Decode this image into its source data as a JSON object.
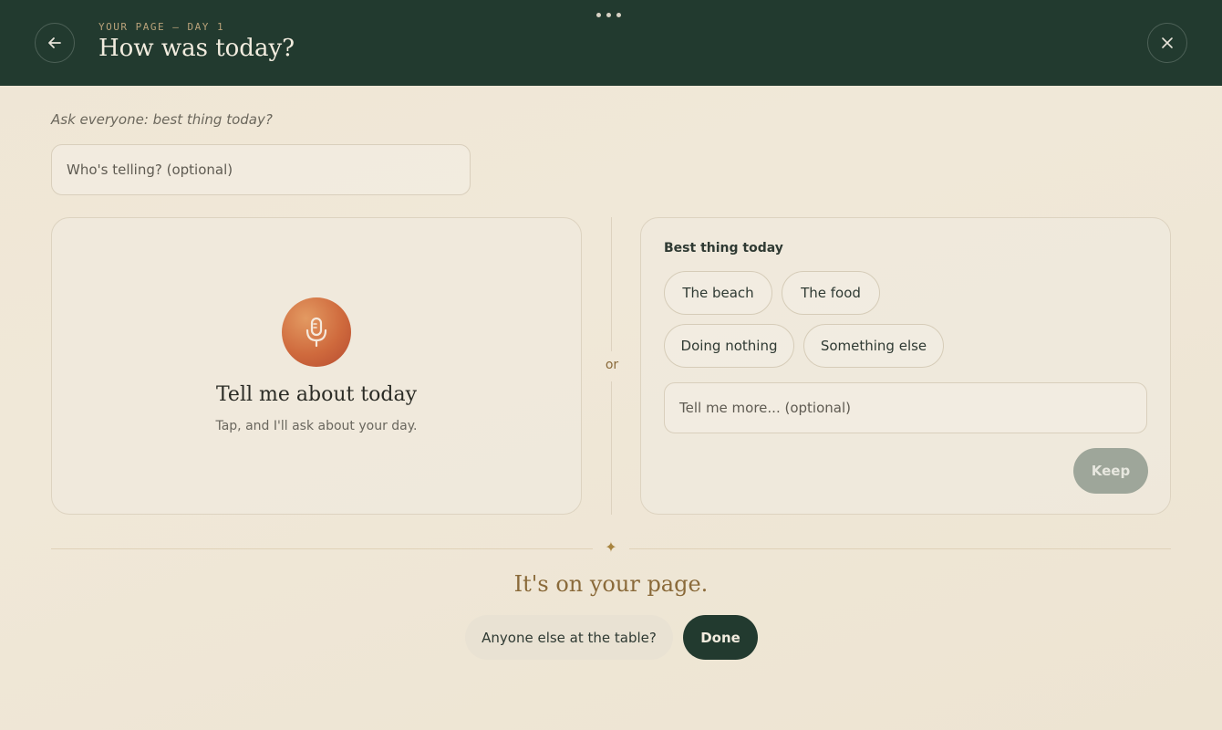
{
  "header": {
    "eyebrow": "YOUR PAGE — DAY 1",
    "title": "How was today?",
    "back_icon": "arrow-left-icon",
    "close_icon": "close-icon",
    "menu_icon": "more-dots-icon"
  },
  "prompt": "Ask everyone: best thing today?",
  "who_input": {
    "placeholder": "Who's telling? (optional)"
  },
  "voice": {
    "icon": "microphone-icon",
    "title": "Tell me about today",
    "subtitle": "Tap, and I'll ask about your day."
  },
  "divider_or": "or",
  "choices": {
    "label": "Best thing today",
    "options": [
      "The beach",
      "The food",
      "Doing nothing",
      "Something else"
    ],
    "more_placeholder": "Tell me more... (optional)",
    "keep_label": "Keep"
  },
  "footer": {
    "sparkle": "✦",
    "message": "It's on your page.",
    "anyone_label": "Anyone else at the table?",
    "done_label": "Done"
  },
  "colors": {
    "header_bg": "#223a2f",
    "accent_gold": "#8a6a3a",
    "mic_orange": "#cf6a3d",
    "keep_disabled": "#9ea69a",
    "page_bg": "#efe6d5"
  }
}
